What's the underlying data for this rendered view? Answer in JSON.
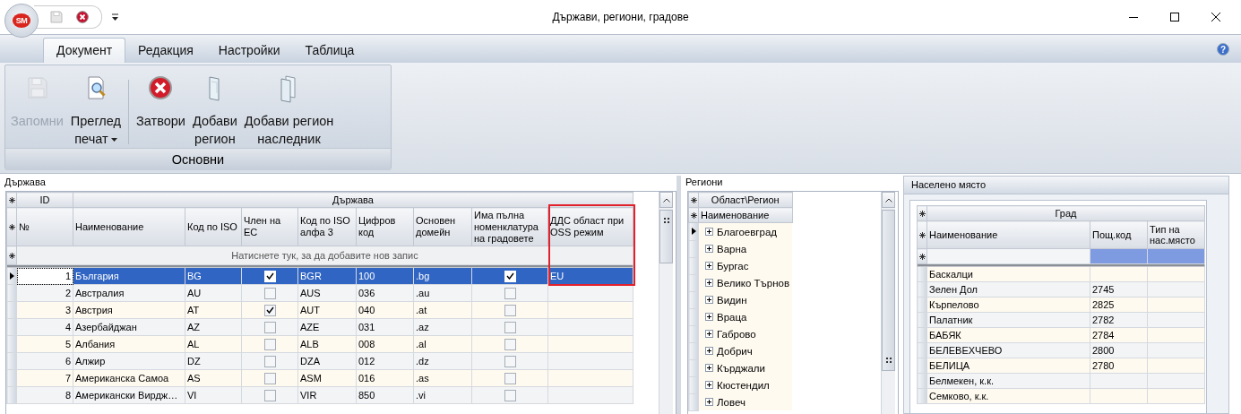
{
  "window": {
    "title": "Държави, региони, градове",
    "logo_text": "SM"
  },
  "tabs": [
    {
      "label": "Документ",
      "selected": true
    },
    {
      "label": "Редакция",
      "selected": false
    },
    {
      "label": "Настройки",
      "selected": false
    },
    {
      "label": "Таблица",
      "selected": false
    }
  ],
  "ribbon": {
    "group_label": "Основни",
    "buttons": [
      {
        "label": "Запомни",
        "disabled": true,
        "dropdown": false
      },
      {
        "label": "Преглед\nпечат",
        "disabled": false,
        "dropdown": true
      },
      {
        "label": "Затвори",
        "disabled": false,
        "dropdown": false
      },
      {
        "label": "Добави\nрегион",
        "disabled": false,
        "dropdown": false
      },
      {
        "label": "Добави регион\nнаследник",
        "disabled": false,
        "dropdown": false
      }
    ]
  },
  "country_panel": {
    "title": "Държава",
    "grid": {
      "band_headers": [
        "ID",
        "Държава"
      ],
      "columns": [
        {
          "label": "№",
          "kind": "number",
          "highlighted": false
        },
        {
          "label": "Наименование",
          "kind": "text",
          "highlighted": false
        },
        {
          "label": "Код по ISO",
          "kind": "text",
          "highlighted": false
        },
        {
          "label": "Член на ЕС",
          "kind": "check",
          "highlighted": false
        },
        {
          "label": "Код по ISO алфа 3",
          "kind": "text",
          "highlighted": false
        },
        {
          "label": "Цифров код",
          "kind": "text",
          "highlighted": false
        },
        {
          "label": "Основен домейн",
          "kind": "text",
          "highlighted": false
        },
        {
          "label": "Има пълна номенклатура на градовете",
          "kind": "check",
          "highlighted": false
        },
        {
          "label": "ДДС област при OSS режим",
          "kind": "text",
          "highlighted": true
        }
      ],
      "new_row_prompt": "Натиснете тук, за да добавите нов запис",
      "rows": [
        {
          "selected": true,
          "cells": [
            "1",
            "България",
            "BG",
            true,
            "BGR",
            "100",
            ".bg",
            true,
            "EU"
          ]
        },
        {
          "selected": false,
          "cells": [
            "2",
            "Австралия",
            "AU",
            false,
            "AUS",
            "036",
            ".au",
            false
          ]
        },
        {
          "selected": false,
          "cells": [
            "3",
            "Австрия",
            "AT",
            true,
            "AUT",
            "040",
            ".at",
            false
          ]
        },
        {
          "selected": false,
          "cells": [
            "4",
            "Азербайджан",
            "AZ",
            false,
            "AZE",
            "031",
            ".az",
            false
          ]
        },
        {
          "selected": false,
          "cells": [
            "5",
            "Албания",
            "AL",
            false,
            "ALB",
            "008",
            ".al",
            false
          ]
        },
        {
          "selected": false,
          "cells": [
            "6",
            "Алжир",
            "DZ",
            false,
            "DZA",
            "012",
            ".dz",
            false
          ]
        },
        {
          "selected": false,
          "cells": [
            "7",
            "Американска Самоа",
            "AS",
            false,
            "ASM",
            "016",
            ".as",
            false
          ]
        },
        {
          "selected": false,
          "cells": [
            "8",
            "Американски Вирдж…",
            "VI",
            false,
            "VIR",
            "850",
            ".vi",
            false
          ]
        }
      ]
    }
  },
  "region_panel": {
    "title": "Региони",
    "band_header": "Област\\Регион",
    "column": "Наименование",
    "items": [
      {
        "label": "Благоевград",
        "selected": true,
        "expanded": false
      },
      {
        "label": "Варна",
        "selected": false,
        "expanded": false
      },
      {
        "label": "Бургас",
        "selected": false,
        "expanded": false
      },
      {
        "label": "Велико Търнов",
        "selected": false,
        "expanded": false
      },
      {
        "label": "Видин",
        "selected": false,
        "expanded": false
      },
      {
        "label": "Враца",
        "selected": false,
        "expanded": false
      },
      {
        "label": "Габрово",
        "selected": false,
        "expanded": false
      },
      {
        "label": "Добрич",
        "selected": false,
        "expanded": false
      },
      {
        "label": "Кърджали",
        "selected": false,
        "expanded": false
      },
      {
        "label": "Кюстендил",
        "selected": false,
        "expanded": false
      },
      {
        "label": "Ловеч",
        "selected": false,
        "expanded": false
      }
    ]
  },
  "city_panel": {
    "title": "Населено място",
    "grid": {
      "band_header": "Град",
      "columns": [
        "Наименование",
        "Пощ.код",
        "Тип на нас.място"
      ],
      "rows": [
        [
          "Баскалци"
        ],
        [
          "Зелен Дол",
          "2745"
        ],
        [
          "Кърпелово",
          "2825"
        ],
        [
          "Палатник",
          "2782"
        ],
        [
          "БАБЯК",
          "2784"
        ],
        [
          "БЕЛЕВЕХЧЕВО",
          "2800"
        ],
        [
          "БЕЛИЦА",
          "2780"
        ],
        [
          "Белмекен, к.к."
        ],
        [
          "Семково, к.к."
        ]
      ]
    }
  },
  "help": {
    "text": "?"
  }
}
